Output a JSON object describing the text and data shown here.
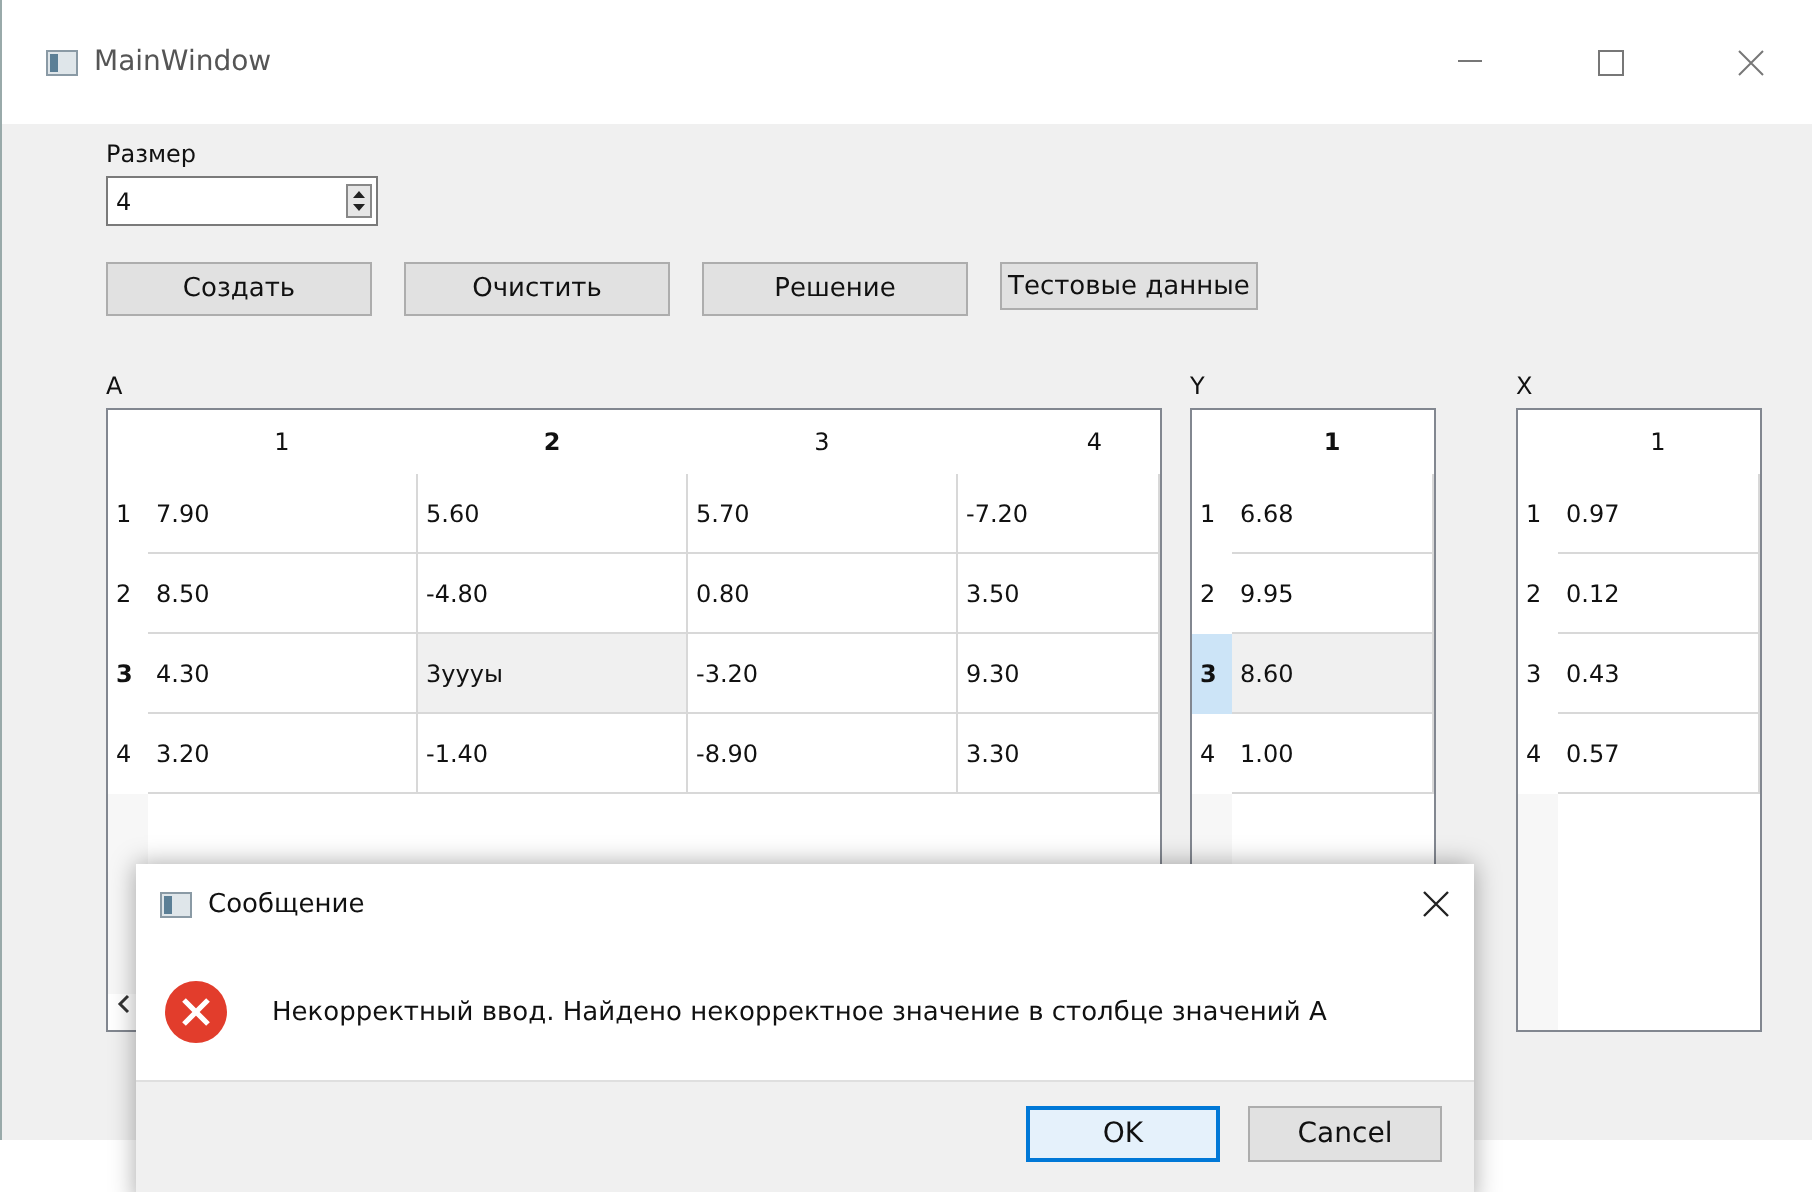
{
  "window": {
    "title": "MainWindow"
  },
  "size": {
    "label": "Размер",
    "value": "4"
  },
  "buttons": [
    {
      "label": "Создать",
      "kind": "wide"
    },
    {
      "label": "Очистить",
      "kind": "wide"
    },
    {
      "label": "Решение",
      "kind": "wide"
    },
    {
      "label": "Тестовые данные",
      "kind": "compact"
    }
  ],
  "tables": [
    {
      "label": "A",
      "columns": [
        {
          "label": "1",
          "selected": false
        },
        {
          "label": "2",
          "selected": true
        },
        {
          "label": "3",
          "selected": false
        },
        {
          "label": "4",
          "selected": false
        }
      ],
      "rows": [
        {
          "label": "1",
          "selected": false,
          "header_highlighted": false,
          "cells": [
            {
              "value": "7.90",
              "current": false
            },
            {
              "value": "5.60",
              "current": false
            },
            {
              "value": "5.70",
              "current": false
            },
            {
              "value": "-7.20",
              "current": false
            }
          ]
        },
        {
          "label": "2",
          "selected": false,
          "header_highlighted": false,
          "cells": [
            {
              "value": "8.50",
              "current": false
            },
            {
              "value": "-4.80",
              "current": false
            },
            {
              "value": "0.80",
              "current": false
            },
            {
              "value": "3.50",
              "current": false
            }
          ]
        },
        {
          "label": "3",
          "selected": true,
          "header_highlighted": false,
          "cells": [
            {
              "value": "4.30",
              "current": false
            },
            {
              "value": "3уууы",
              "current": true
            },
            {
              "value": "-3.20",
              "current": false
            },
            {
              "value": "9.30",
              "current": false
            }
          ]
        },
        {
          "label": "4",
          "selected": false,
          "header_highlighted": false,
          "cells": [
            {
              "value": "3.20",
              "current": false
            },
            {
              "value": "-1.40",
              "current": false
            },
            {
              "value": "-8.90",
              "current": false
            },
            {
              "value": "3.30",
              "current": false
            }
          ]
        }
      ]
    },
    {
      "label": "Y",
      "columns": [
        {
          "label": "1",
          "selected": true
        }
      ],
      "rows": [
        {
          "label": "1",
          "selected": false,
          "header_highlighted": false,
          "cells": [
            {
              "value": "6.68",
              "current": false
            }
          ]
        },
        {
          "label": "2",
          "selected": false,
          "header_highlighted": false,
          "cells": [
            {
              "value": "9.95",
              "current": false
            }
          ]
        },
        {
          "label": "3",
          "selected": true,
          "header_highlighted": true,
          "cells": [
            {
              "value": "8.60",
              "current": true
            }
          ]
        },
        {
          "label": "4",
          "selected": false,
          "header_highlighted": false,
          "cells": [
            {
              "value": "1.00",
              "current": false
            }
          ]
        }
      ]
    },
    {
      "label": "X",
      "columns": [
        {
          "label": "1",
          "selected": false
        }
      ],
      "rows": [
        {
          "label": "1",
          "selected": false,
          "header_highlighted": false,
          "cells": [
            {
              "value": "0.97",
              "current": false
            }
          ]
        },
        {
          "label": "2",
          "selected": false,
          "header_highlighted": false,
          "cells": [
            {
              "value": "0.12",
              "current": false
            }
          ]
        },
        {
          "label": "3",
          "selected": false,
          "header_highlighted": false,
          "cells": [
            {
              "value": "0.43",
              "current": false
            }
          ]
        },
        {
          "label": "4",
          "selected": false,
          "header_highlighted": false,
          "cells": [
            {
              "value": "0.57",
              "current": false
            }
          ]
        }
      ]
    }
  ],
  "dialog": {
    "title": "Сообщение",
    "message": "Некорректный ввод. Найдено некорректное значение в столбце значений A",
    "buttons": [
      {
        "label": "OK",
        "selected": true
      },
      {
        "label": "Cancel",
        "selected": false
      }
    ]
  }
}
